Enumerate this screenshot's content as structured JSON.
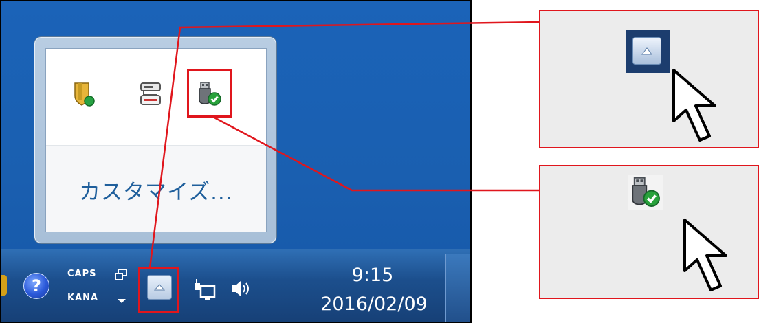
{
  "flyout": {
    "customize_label": "カスタマイズ...",
    "icons": [
      "security-shield-icon",
      "network-drive-icon",
      "usb-safely-remove-icon"
    ]
  },
  "taskbar": {
    "caps_label": "CAPS",
    "kana_label": "KANA",
    "time": "9:15",
    "date": "2016/02/09",
    "icons": [
      "help-icon",
      "input-mode-icon",
      "show-hidden-icons-button",
      "network-icon",
      "volume-icon"
    ]
  },
  "callouts": {
    "top_panel_icon": "show-hidden-icons-button",
    "bottom_panel_icon": "usb-safely-remove-icon"
  },
  "colors": {
    "highlight": "#e0161d",
    "desktop_blue": "#1b63b8",
    "link_blue": "#1f5f9c",
    "check_green": "#28a23b"
  }
}
